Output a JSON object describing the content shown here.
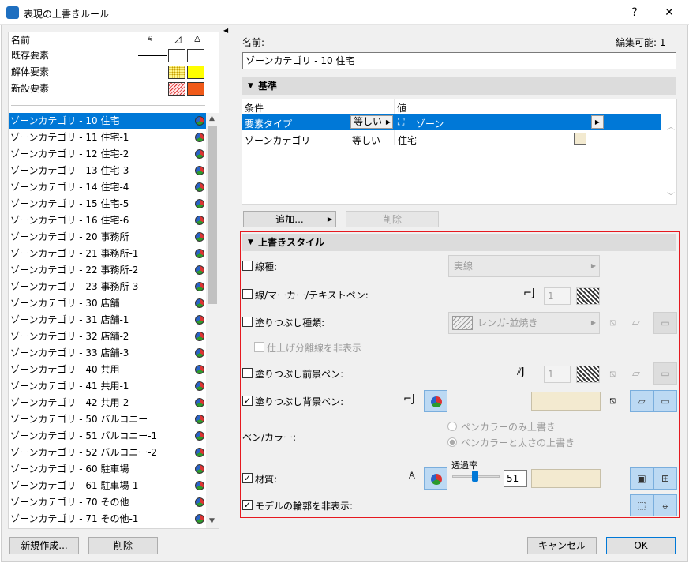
{
  "window": {
    "title": "表現の上書きルール",
    "help": "?",
    "close": "✕"
  },
  "left": {
    "header_name": "名前",
    "legend": [
      {
        "label": "既存要素",
        "type": "existing"
      },
      {
        "label": "解体要素",
        "type": "demolish"
      },
      {
        "label": "新設要素",
        "type": "new"
      }
    ],
    "rules": [
      "ゾーンカテゴリ - 10 住宅",
      "ゾーンカテゴリ - 11 住宅-1",
      "ゾーンカテゴリ - 12 住宅-2",
      "ゾーンカテゴリ - 13 住宅-3",
      "ゾーンカテゴリ - 14 住宅-4",
      "ゾーンカテゴリ - 15 住宅-5",
      "ゾーンカテゴリ - 16 住宅-6",
      "ゾーンカテゴリ - 20 事務所",
      "ゾーンカテゴリ - 21 事務所-1",
      "ゾーンカテゴリ - 22 事務所-2",
      "ゾーンカテゴリ - 23 事務所-3",
      "ゾーンカテゴリ - 30 店舗",
      "ゾーンカテゴリ - 31 店舗-1",
      "ゾーンカテゴリ - 32 店舗-2",
      "ゾーンカテゴリ - 33 店舗-3",
      "ゾーンカテゴリ - 40 共用",
      "ゾーンカテゴリ - 41 共用-1",
      "ゾーンカテゴリ - 42 共用-2",
      "ゾーンカテゴリ - 50 バルコニー",
      "ゾーンカテゴリ - 51 バルコニー-1",
      "ゾーンカテゴリ - 52 バルコニー-2",
      "ゾーンカテゴリ - 60 駐車場",
      "ゾーンカテゴリ - 61 駐車場-1",
      "ゾーンカテゴリ - 70 その他",
      "ゾーンカテゴリ - 71 その他-1"
    ],
    "selected_index": 0,
    "new_button": "新規作成...",
    "delete_button": "削除"
  },
  "right": {
    "name_label": "名前:",
    "editable_label": "編集可能: 1",
    "name_value": "ゾーンカテゴリ - 10 住宅",
    "criteria_header": "基準",
    "table_headers": {
      "condition": "条件",
      "value": "値"
    },
    "rows": [
      {
        "condition": "要素タイプ",
        "operator": "等しい",
        "value": "ゾーン"
      },
      {
        "condition": "ゾーンカテゴリ",
        "operator": "等しい",
        "value": "住宅"
      }
    ],
    "add_button": "追加...",
    "remove_button": "削除",
    "style_header": "上書きスタイル",
    "options": {
      "line_type": {
        "label": "線種:",
        "value": "実線",
        "checked": false
      },
      "line_pen": {
        "label": "線/マーカー/テキストペン:",
        "value": "1",
        "checked": false
      },
      "fill_type": {
        "label": "塗りつぶし種類:",
        "value": "レンガ-並焼き",
        "checked": false
      },
      "hide_sep": {
        "label": "仕上げ分離線を非表示",
        "checked": false
      },
      "fill_fg": {
        "label": "塗りつぶし前景ペン:",
        "value": "1",
        "checked": false
      },
      "fill_bg": {
        "label": "塗りつぶし背景ペン:",
        "checked": true
      },
      "pen_color_label": "ペン/カラー:",
      "radio1": "ペンカラーのみ上書き",
      "radio2": "ペンカラーと太さの上書き",
      "material": {
        "label": "材質:",
        "checked": true
      },
      "transparency_label": "透過率",
      "transparency_value": "51",
      "hide_contours": {
        "label": "モデルの輪郭を非表示:",
        "checked": true
      }
    },
    "cancel_button": "キャンセル",
    "ok_button": "OK"
  }
}
